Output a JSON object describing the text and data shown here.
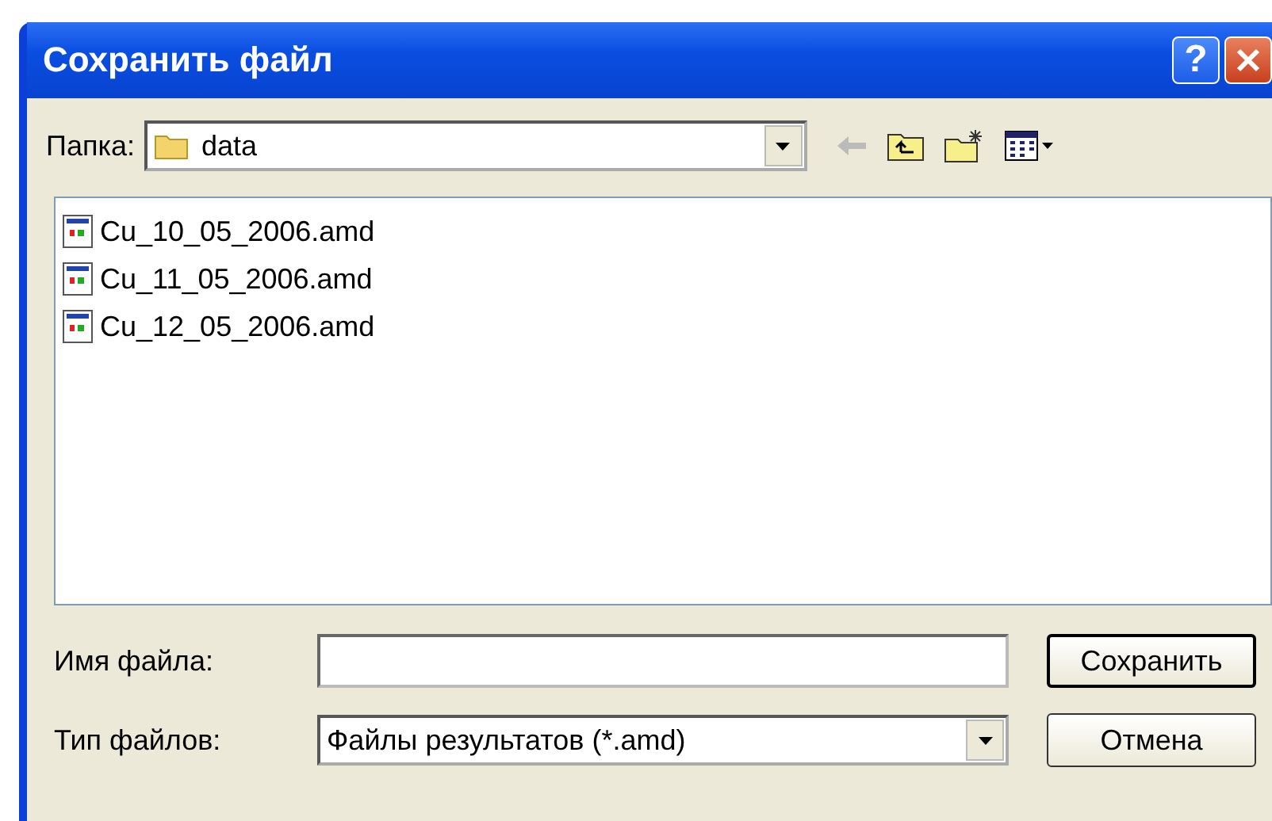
{
  "window": {
    "title": "Сохранить файл",
    "help": "?"
  },
  "folder": {
    "label": "Папка:",
    "value": "data"
  },
  "files": [
    {
      "name": "Cu_10_05_2006.amd"
    },
    {
      "name": "Cu_11_05_2006.amd"
    },
    {
      "name": "Cu_12_05_2006.amd"
    }
  ],
  "filename": {
    "label": "Имя файла:"
  },
  "filetype": {
    "label": "Тип файлов:",
    "value": "Файлы результатов (*.amd)"
  },
  "buttons": [
    "Сохранить",
    "Отмена"
  ]
}
